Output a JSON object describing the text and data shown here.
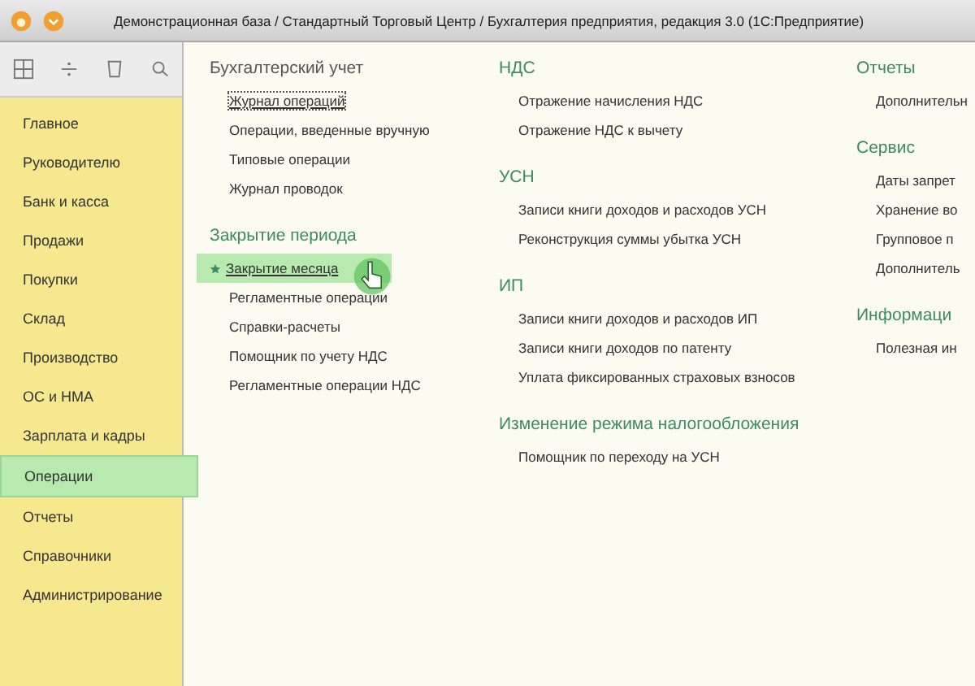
{
  "window": {
    "title": "Демонстрационная база / Стандартный Торговый Центр / Бухгалтерия предприятия, редакция 3.0 (1С:Предприятие)"
  },
  "sidebar": {
    "items": [
      {
        "label": "Главное",
        "selected": false
      },
      {
        "label": "Руководителю",
        "selected": false
      },
      {
        "label": "Банк и касса",
        "selected": false
      },
      {
        "label": "Продажи",
        "selected": false
      },
      {
        "label": "Покупки",
        "selected": false
      },
      {
        "label": "Склад",
        "selected": false
      },
      {
        "label": "Производство",
        "selected": false
      },
      {
        "label": "ОС и НМА",
        "selected": false
      },
      {
        "label": "Зарплата и кадры",
        "selected": false
      },
      {
        "label": "Операции",
        "selected": true
      },
      {
        "label": "Отчеты",
        "selected": false
      },
      {
        "label": "Справочники",
        "selected": false
      },
      {
        "label": "Администрирование",
        "selected": false
      }
    ]
  },
  "columns": [
    {
      "groups": [
        {
          "title": "Бухгалтерский учет",
          "items": [
            {
              "label": "Журнал операций",
              "focused": true,
              "highlighted": false,
              "favorite": false
            },
            {
              "label": "Операции, введенные вручную",
              "focused": false,
              "highlighted": false,
              "favorite": false
            },
            {
              "label": "Типовые операции",
              "focused": false,
              "highlighted": false,
              "favorite": false
            },
            {
              "label": "Журнал проводок",
              "focused": false,
              "highlighted": false,
              "favorite": false
            }
          ]
        },
        {
          "title": "Закрытие периода",
          "items": [
            {
              "label": "Закрытие месяца",
              "focused": false,
              "highlighted": true,
              "favorite": true
            },
            {
              "label": "Регламентные операции",
              "focused": false,
              "highlighted": false,
              "favorite": false
            },
            {
              "label": "Справки-расчеты",
              "focused": false,
              "highlighted": false,
              "favorite": false
            },
            {
              "label": "Помощник по учету НДС",
              "focused": false,
              "highlighted": false,
              "favorite": false
            },
            {
              "label": "Регламентные операции НДС",
              "focused": false,
              "highlighted": false,
              "favorite": false
            }
          ]
        }
      ]
    },
    {
      "groups": [
        {
          "title": "НДС",
          "items": [
            {
              "label": "Отражение начисления НДС",
              "focused": false,
              "highlighted": false,
              "favorite": false
            },
            {
              "label": "Отражение НДС к вычету",
              "focused": false,
              "highlighted": false,
              "favorite": false
            }
          ]
        },
        {
          "title": "УСН",
          "items": [
            {
              "label": "Записи книги доходов и расходов УСН",
              "focused": false,
              "highlighted": false,
              "favorite": false
            },
            {
              "label": "Реконструкция суммы убытка УСН",
              "focused": false,
              "highlighted": false,
              "favorite": false
            }
          ]
        },
        {
          "title": "ИП",
          "items": [
            {
              "label": "Записи книги доходов и расходов ИП",
              "focused": false,
              "highlighted": false,
              "favorite": false
            },
            {
              "label": "Записи книги доходов по патенту",
              "focused": false,
              "highlighted": false,
              "favorite": false
            },
            {
              "label": "Уплата фиксированных страховых взносов",
              "focused": false,
              "highlighted": false,
              "favorite": false
            }
          ]
        },
        {
          "title": "Изменение режима налогообложения",
          "items": [
            {
              "label": "Помощник по переходу на УСН",
              "focused": false,
              "highlighted": false,
              "favorite": false
            }
          ]
        }
      ]
    },
    {
      "groups": [
        {
          "title": "Отчеты",
          "items": [
            {
              "label": "Дополнительн",
              "focused": false,
              "highlighted": false,
              "favorite": false
            }
          ]
        },
        {
          "title": "Сервис",
          "items": [
            {
              "label": "Даты запрет",
              "focused": false,
              "highlighted": false,
              "favorite": false
            },
            {
              "label": "Хранение во",
              "focused": false,
              "highlighted": false,
              "favorite": false
            },
            {
              "label": "Групповое п",
              "focused": false,
              "highlighted": false,
              "favorite": false
            },
            {
              "label": "Дополнитель",
              "focused": false,
              "highlighted": false,
              "favorite": false
            }
          ]
        },
        {
          "title": "Информаци",
          "items": [
            {
              "label": "Полезная ин",
              "focused": false,
              "highlighted": false,
              "favorite": false
            }
          ]
        }
      ]
    }
  ]
}
